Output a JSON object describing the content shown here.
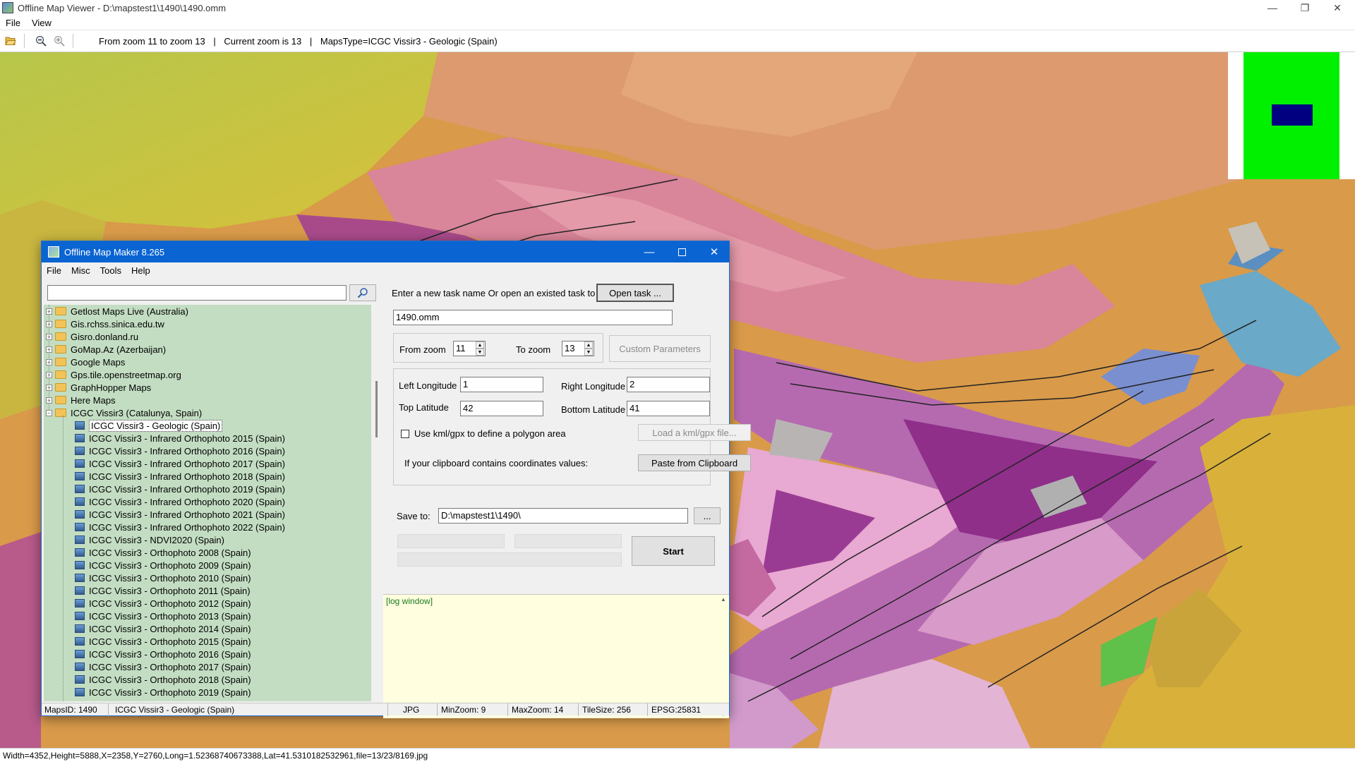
{
  "window": {
    "title": "Offline Map Viewer - D:\\mapstest1\\1490\\1490.omm",
    "controls": {
      "minimize": "—",
      "restore": "❐",
      "close": "✕"
    }
  },
  "menu": [
    "File",
    "View"
  ],
  "toolbar": {
    "zoom_range": "From zoom 11 to zoom 13",
    "sep1": "|",
    "current_zoom": "Current zoom is 13",
    "sep2": "|",
    "maps_type": "MapsType=ICGC Vissir3 - Geologic (Spain)",
    "icons": [
      "folder-open-icon",
      "zoom-out-icon",
      "zoom-in-icon"
    ]
  },
  "overview_colors": {
    "background": "#00f000",
    "viewport": "#000080"
  },
  "statusbar": "Width=4352,Height=5888,X=2358,Y=2760,Long=1.52368740673388,Lat=41.5310182532961,file=13/23/8169.jpg",
  "dialog": {
    "title": "Offline Map Maker 8.265",
    "menu": [
      "File",
      "Misc",
      "Tools",
      "Help"
    ],
    "search": {
      "value": "",
      "button_icon": "search-icon"
    },
    "tree": {
      "groups": [
        "Getlost Maps Live (Australia)",
        "Gis.rchss.sinica.edu.tw",
        "Gisro.donland.ru",
        "GoMap.Az (Azerbaijan)",
        "Google Maps",
        "Gps.tile.openstreetmap.org",
        "GraphHopper Maps",
        "Here Maps"
      ],
      "expanded_group": "ICGC Vissir3 (Catalunya, Spain)",
      "selected": "ICGC Vissir3 - Geologic (Spain)",
      "children": [
        "ICGC Vissir3 - Infrared Orthophoto 2015 (Spain)",
        "ICGC Vissir3 - Infrared Orthophoto 2016 (Spain)",
        "ICGC Vissir3 - Infrared Orthophoto 2017 (Spain)",
        "ICGC Vissir3 - Infrared Orthophoto 2018 (Spain)",
        "ICGC Vissir3 - Infrared Orthophoto 2019 (Spain)",
        "ICGC Vissir3 - Infrared Orthophoto 2020 (Spain)",
        "ICGC Vissir3 - Infrared Orthophoto 2021 (Spain)",
        "ICGC Vissir3 - Infrared Orthophoto 2022 (Spain)",
        "ICGC Vissir3 - NDVI2020 (Spain)",
        "ICGC Vissir3 - Orthophoto 2008 (Spain)",
        "ICGC Vissir3 - Orthophoto 2009 (Spain)",
        "ICGC Vissir3 - Orthophoto 2010 (Spain)",
        "ICGC Vissir3 - Orthophoto 2011 (Spain)",
        "ICGC Vissir3 - Orthophoto 2012 (Spain)",
        "ICGC Vissir3 - Orthophoto 2013 (Spain)",
        "ICGC Vissir3 - Orthophoto 2014 (Spain)",
        "ICGC Vissir3 - Orthophoto 2015 (Spain)",
        "ICGC Vissir3 - Orthophoto 2016 (Spain)",
        "ICGC Vissir3 - Orthophoto 2017 (Spain)",
        "ICGC Vissir3 - Orthophoto 2018 (Spain)",
        "ICGC Vissir3 - Orthophoto 2019 (Spain)"
      ]
    },
    "task": {
      "prompt": "Enter a new task name Or open an existed task to continue:",
      "open_button": "Open task ...",
      "name": "1490.omm"
    },
    "zoom": {
      "from_label": "From zoom",
      "from_value": "11",
      "to_label": "To zoom",
      "to_value": "13",
      "custom_button": "Custom Parameters"
    },
    "area": {
      "left_lon_label": "Left Longitude",
      "left_lon": "1",
      "right_lon_label": "Right Longitude",
      "right_lon": "2",
      "top_lat_label": "Top Latitude",
      "top_lat": "42",
      "bottom_lat_label": "Bottom Latitude",
      "bottom_lat": "41",
      "kml_checkbox": "Use kml/gpx to define a polygon area",
      "kml_checked": false,
      "load_kml_button": "Load a kml/gpx file...",
      "clipboard_label": "If your clipboard contains coordinates values:",
      "paste_button": "Paste from Clipboard"
    },
    "save": {
      "label": "Save to:",
      "path": "D:\\mapstest1\\1490\\",
      "browse_button": "...",
      "start_button": "Start"
    },
    "log": "[log window]",
    "status": {
      "maps_id": "MapsID: 1490",
      "map_name": "ICGC Vissir3 - Geologic (Spain)",
      "format": "JPG",
      "min_zoom": "MinZoom: 9",
      "max_zoom": "MaxZoom: 14",
      "tile_size": "TileSize: 256",
      "epsg": "EPSG:25831"
    }
  }
}
